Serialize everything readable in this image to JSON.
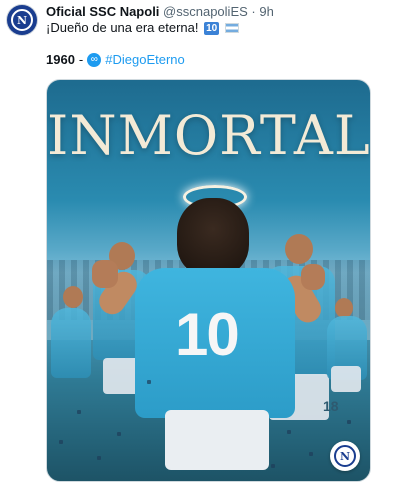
{
  "post": {
    "author_name": "Oficial SSC Napoli",
    "handle": "@sscnapoliES",
    "separator": "·",
    "time": "9h",
    "text": "¡Dueño de una era eterna!",
    "emoji_10": "10",
    "year": "1960",
    "dash": "-",
    "hashtag": "#DiegoEterno",
    "avatar_letter": "N"
  },
  "image": {
    "headline": "INMORTAL",
    "jersey_number": "10",
    "side_number": "18",
    "badge_letter": "N"
  },
  "colors": {
    "handle_gray": "#536471",
    "link_blue": "#1d9bf0",
    "napoli_blue": "#1a3d8f",
    "jersey_blue": "#3fb5df"
  },
  "icons": {
    "avatar": "napoli-logo",
    "hashtag_icon": "infinity-hashflag",
    "flag": "argentina-flag"
  }
}
